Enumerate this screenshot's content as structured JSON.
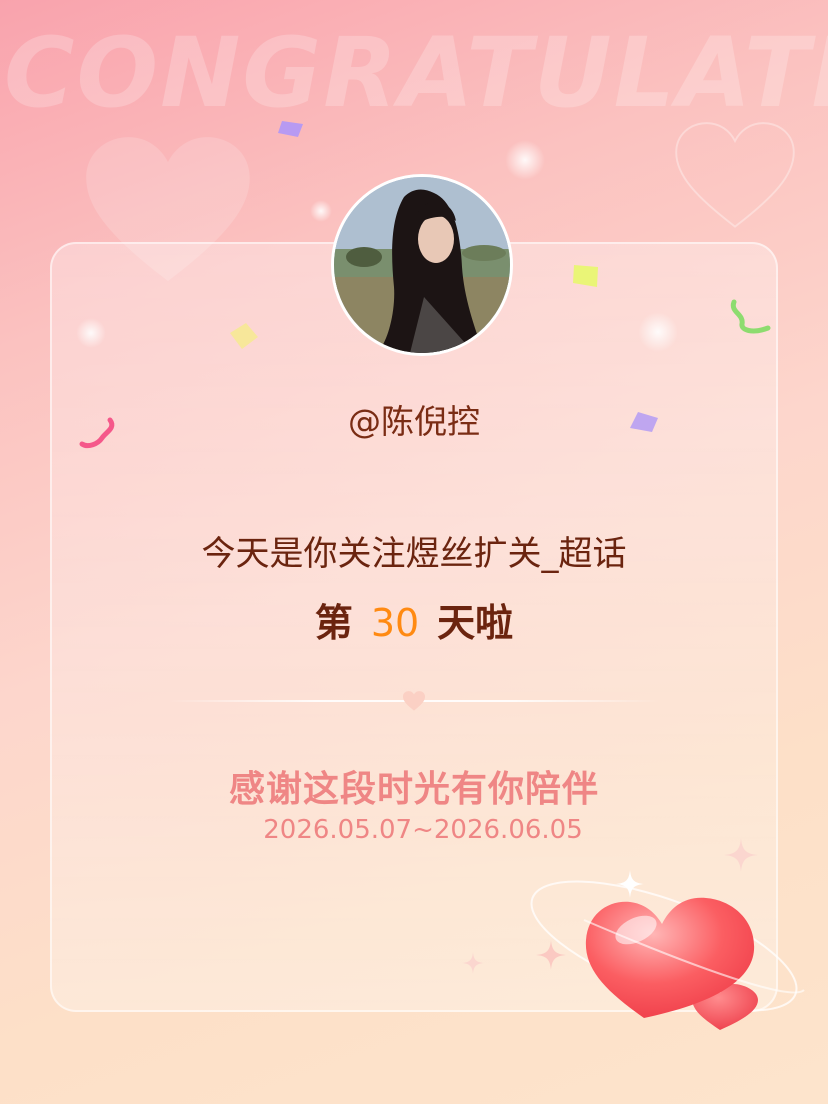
{
  "background": {
    "watermark_text": "CONGRATULATE",
    "colors": {
      "top": "#f9a3ad",
      "bottom": "#fde4cc"
    }
  },
  "profile": {
    "username": "@陈倪控"
  },
  "message": {
    "line1": "今天是你关注煜丝扩关_超话",
    "prefix": "第",
    "days": "30",
    "suffix": "天啦"
  },
  "footer": {
    "thanks": "感谢这段时光有你陪伴",
    "date_range": "2026.05.07~2026.06.05"
  },
  "colors": {
    "text_brown": "#6b240f",
    "accent_orange": "#ff8a12",
    "accent_pink": "#ef8685"
  },
  "icons": [
    "heart-icon",
    "sparkle-icon",
    "confetti-icon"
  ]
}
